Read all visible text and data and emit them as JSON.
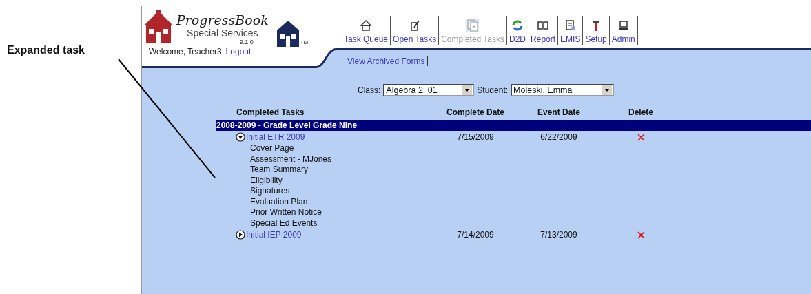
{
  "annotation": {
    "label": "Expanded task"
  },
  "logo": {
    "title": "ProgressBook",
    "subtitle": "Special Services",
    "version": "9.1.0",
    "trademark": "TM"
  },
  "welcome": "Welcome, Teacher3",
  "logout": "Logout",
  "nav": [
    {
      "label": "Task Queue",
      "kind": "home",
      "selected": false
    },
    {
      "label": "Open Tasks",
      "kind": "pencil",
      "selected": false
    },
    {
      "label": "Completed Tasks",
      "kind": "pages",
      "selected": true
    },
    {
      "label": "D2D",
      "kind": "sync",
      "selected": false
    },
    {
      "label": "Report",
      "kind": "book",
      "selected": false
    },
    {
      "label": "EMIS",
      "kind": "doc",
      "selected": false
    },
    {
      "label": "Setup",
      "kind": "tool",
      "selected": false
    },
    {
      "label": "Admin",
      "kind": "computer",
      "selected": false
    }
  ],
  "subnav": [
    "View Archived Forms"
  ],
  "filters": [
    {
      "label": "Class:",
      "value": "Algebra 2: 01"
    },
    {
      "label": "Student:",
      "value": "Moleski, Emma"
    }
  ],
  "table": {
    "columns": [
      "Completed Tasks",
      "Complete Date",
      "Event Date",
      "Delete"
    ],
    "groups": [
      {
        "title": "2008-2009 - Grade Level Grade Nine",
        "tasks": [
          {
            "name": "Initial ETR 2009",
            "expanded": true,
            "complete_date": "7/15/2009",
            "event_date": "6/22/2009",
            "children": [
              {
                "name": "Cover Page"
              },
              {
                "name": "Assessment - MJones"
              },
              {
                "name": "Team Summary"
              },
              {
                "name": "Eligibility"
              },
              {
                "name": "Signatures"
              },
              {
                "name": "Evaluation Plan"
              },
              {
                "name": "Prior Written Notice"
              },
              {
                "name": "Special Ed Events"
              }
            ]
          },
          {
            "name": "Initial IEP 2009",
            "expanded": false,
            "complete_date": "7/14/2009",
            "event_date": "7/13/2009"
          }
        ]
      }
    ]
  }
}
